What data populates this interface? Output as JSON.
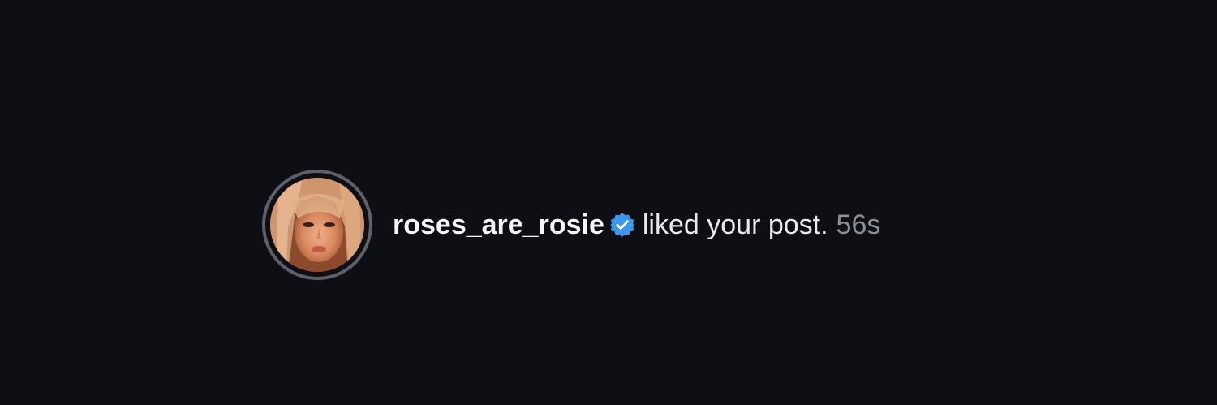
{
  "notification": {
    "username": "roses_are_rosie",
    "verified_icon": "verified-badge-icon",
    "verified_color": "#3897f0",
    "action_text": "liked your post.",
    "timestamp": "56s"
  },
  "colors": {
    "background": "#0d0f14",
    "avatar_ring": "#5d6068",
    "username": "#f4f5f7",
    "action": "#e9eaed",
    "timestamp": "#8a8e97"
  }
}
